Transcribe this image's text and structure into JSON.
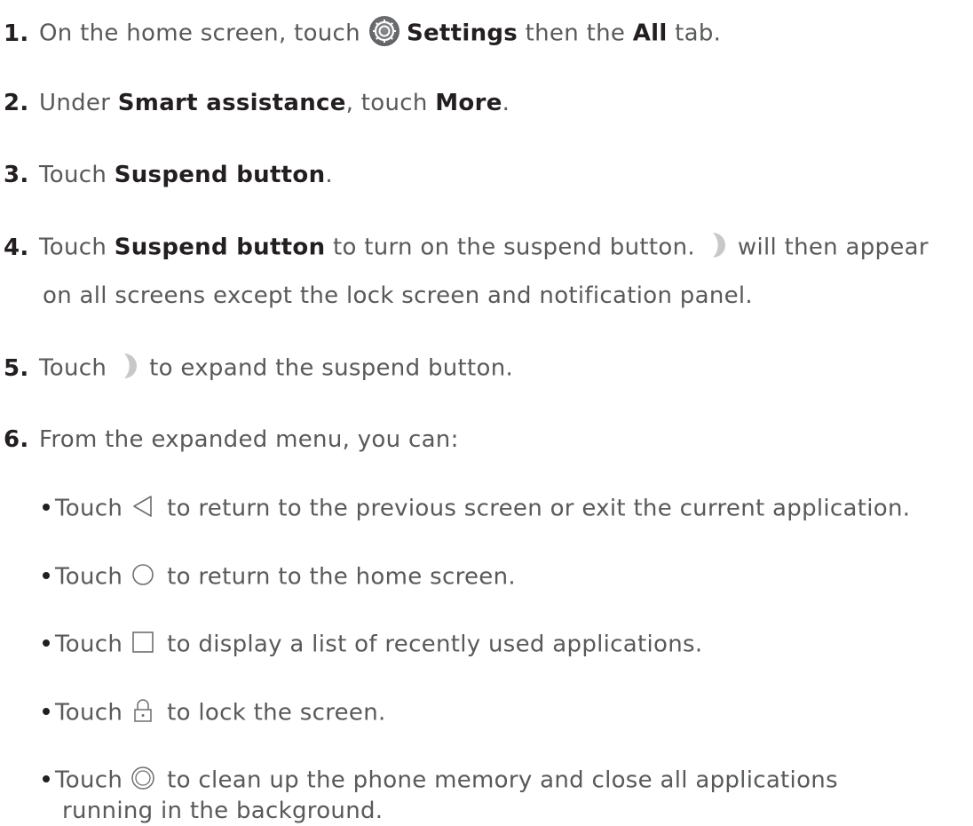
{
  "steps": [
    {
      "number": "1.",
      "t1": "On the home screen, touch",
      "b1": "Settings",
      "t2": "then the",
      "b2": "All",
      "t3": "tab."
    },
    {
      "number": "2.",
      "t1": "Under",
      "b1": "Smart assistance",
      "t2": ",  touch",
      "b2": "More",
      "t3": "."
    },
    {
      "number": "3.",
      "t1": "Touch",
      "b1": "Suspend button",
      "t2": "."
    },
    {
      "number": "4.",
      "t1": "Touch",
      "b1": "Suspend button",
      "t2": "to turn on the suspend button.",
      "t3": "will then appear",
      "cont": "on all screens except the lock screen and notification panel."
    },
    {
      "number": "5.",
      "t1": "Touch",
      "t2": "to expand the suspend button."
    },
    {
      "number": "6.",
      "t1": "From the expanded menu, you can:"
    }
  ],
  "options": [
    {
      "t1": "Touch",
      "icon": "back-triangle-icon",
      "t2": "to return to the previous screen or exit the current application."
    },
    {
      "t1": "Touch",
      "icon": "home-circle-icon",
      "t2": "to return to the home screen."
    },
    {
      "t1": "Touch",
      "icon": "recent-square-icon",
      "t2": "to display a list of recently used applications."
    },
    {
      "t1": "Touch",
      "icon": "lock-icon",
      "t2": "to lock the screen."
    },
    {
      "t1": "Touch",
      "icon": "clean-memory-icon",
      "t2": "to clean up the phone memory and close all applications",
      "cont": "running in the background."
    }
  ],
  "icons": {
    "settings": "settings-gear-icon",
    "suspend": "suspend-button-icon"
  },
  "colors": {
    "text": "#58595b",
    "bold": "#231f20",
    "icon_gray": "#5e6063",
    "suspend_gray": "#c7c8ca"
  }
}
